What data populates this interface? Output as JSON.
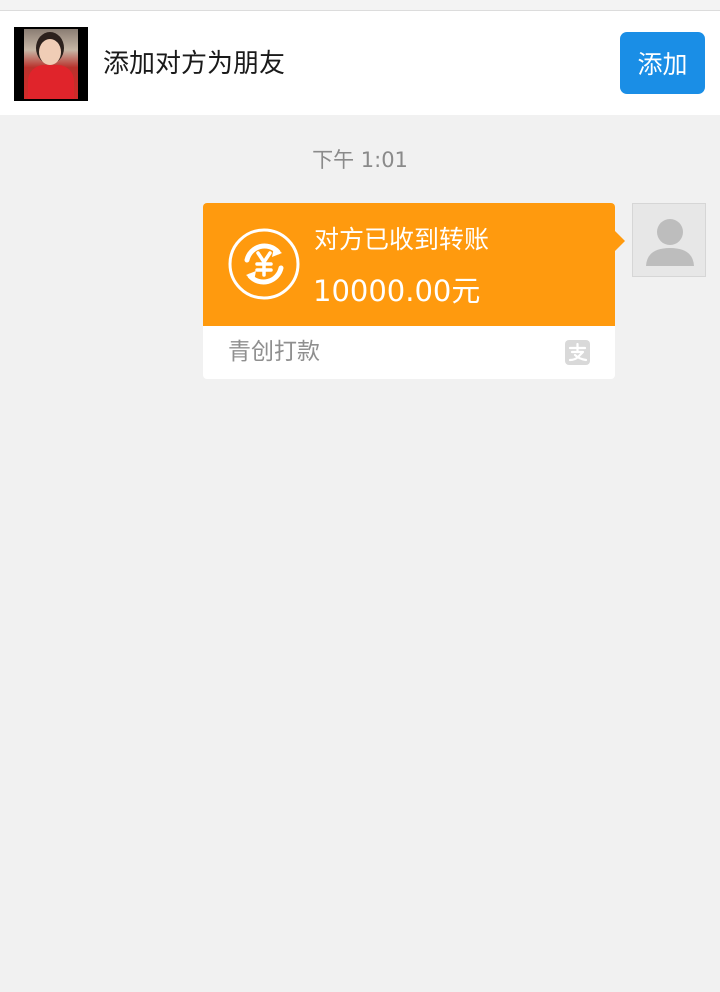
{
  "friend_bar": {
    "prompt": "添加对方为朋友",
    "add_label": "添加"
  },
  "chat": {
    "timestamp": "下午 1:01",
    "transfer": {
      "status": "对方已收到转账",
      "amount": "10000.00元",
      "note": "青创打款"
    }
  },
  "icons": {
    "friend_avatar": "avatar-photo",
    "my_avatar": "default-person-icon",
    "transfer": "yuan-exchange-icon",
    "payment_service": "alipay-icon"
  },
  "colors": {
    "accent_blue": "#1a8ee6",
    "transfer_orange": "#ff9a0e",
    "background": "#f1f1f1"
  }
}
